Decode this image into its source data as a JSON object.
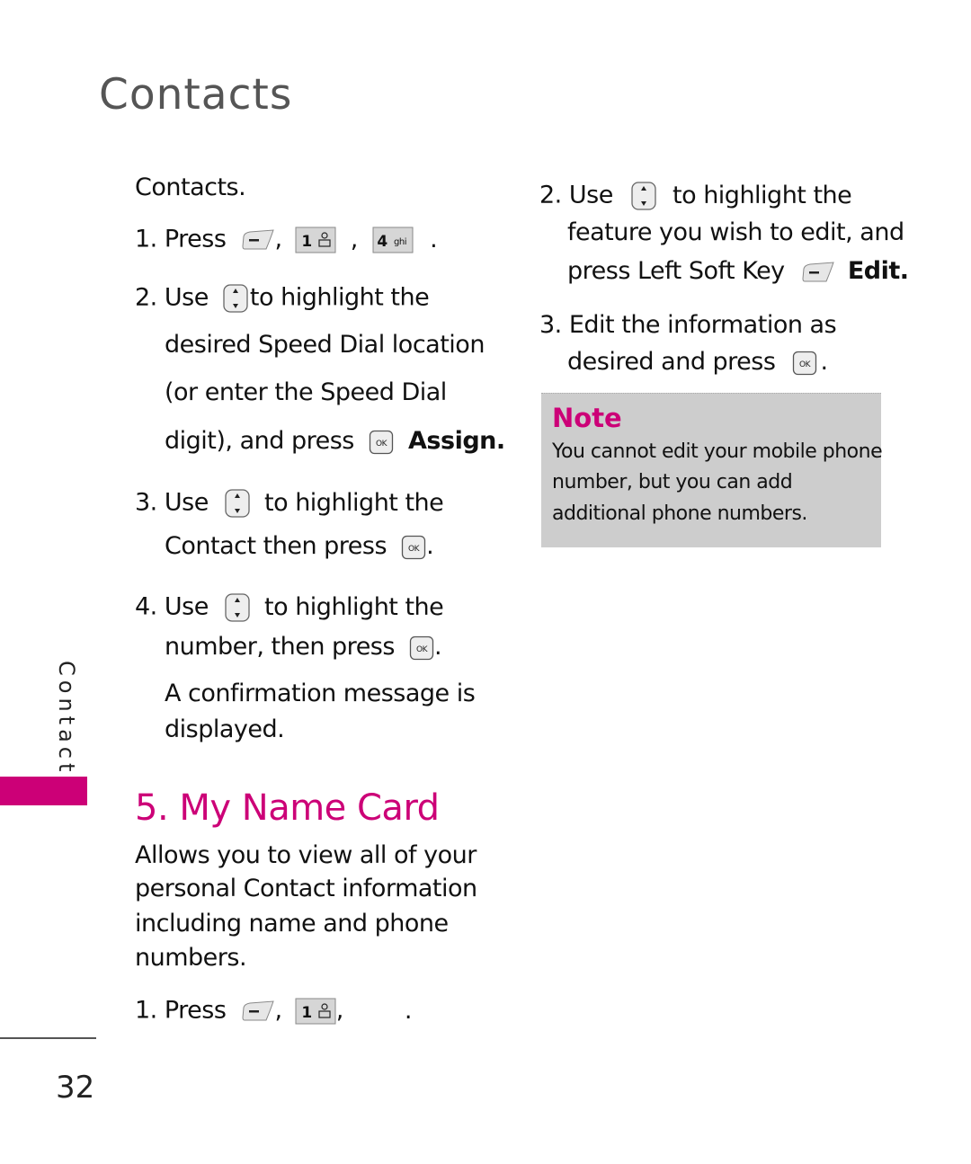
{
  "page": {
    "title": "Contacts",
    "side_tab": "Contacts",
    "page_number": "32",
    "accent_color": "#cc0077"
  },
  "left": {
    "intro": "Contacts.",
    "steps": [
      {
        "num": "1.",
        "text": "Press",
        "keys": [
          "left-soft-key",
          "1-key",
          "4-key"
        ]
      },
      {
        "num": "2.",
        "pre": "Use",
        "post": "to highlight the",
        "lines": [
          "desired Speed Dial location",
          "(or enter the Speed Dial",
          "digit), and press"
        ],
        "action": "Assign."
      },
      {
        "num": "3.",
        "pre": "Use",
        "post": "to highlight the",
        "lines": [
          "Contact then press"
        ]
      },
      {
        "num": "4.",
        "pre": "Use",
        "post": "to highlight the",
        "lines": [
          "number, then press"
        ]
      }
    ],
    "confirmation": [
      "A confirmation message is",
      "displayed."
    ]
  },
  "section": {
    "heading": "5. My Name Card",
    "description": [
      "Allows you to view all of your",
      "personal Contact information",
      "including name and phone",
      "numbers."
    ],
    "step1": {
      "num": "1.",
      "text": "Press"
    }
  },
  "right": {
    "step2": {
      "num": "2.",
      "pre": "Use",
      "post": "to highlight the",
      "line2": "feature you wish to edit, and",
      "line3": "press Left Soft Key",
      "action": "Edit."
    },
    "step3": {
      "num": "3.",
      "line1": "Edit the information as",
      "line2": "desired and press"
    }
  },
  "note": {
    "title": "Note",
    "lines": [
      "You cannot edit your mobile phone",
      "number, but you can add",
      "additional phone numbers."
    ]
  },
  "keys": {
    "one_key_label": "1",
    "four_key_label": "4",
    "four_key_letters": "ghi",
    "ok_label": "OK",
    "comma": ",",
    "period": "."
  }
}
